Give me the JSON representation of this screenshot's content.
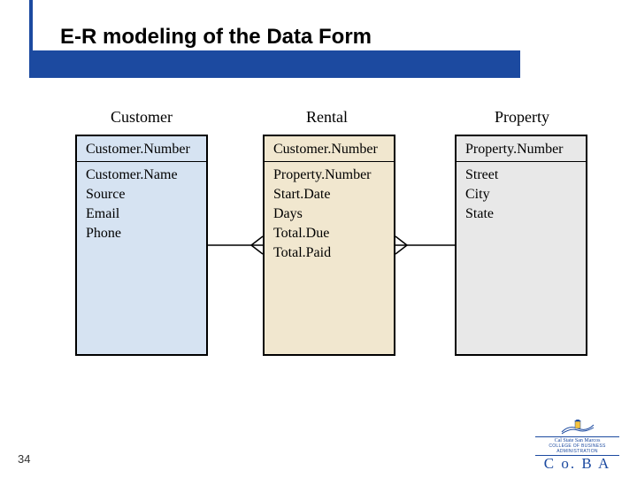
{
  "slide": {
    "title": "E-R modeling of the Data Form",
    "page_number": "34"
  },
  "entities": {
    "customer": {
      "title": "Customer",
      "pk": "Customer.Number",
      "attrs": [
        "Customer.Name",
        "Source",
        "Email",
        "Phone"
      ]
    },
    "rental": {
      "title": "Rental",
      "pk": "Customer.Number",
      "attrs": [
        "Property.Number",
        "Start.Date",
        "Days",
        "Total.Due",
        "Total.Paid"
      ]
    },
    "property": {
      "title": "Property",
      "pk": "Property.Number",
      "attrs": [
        "Street",
        "City",
        "State"
      ]
    }
  },
  "logo": {
    "line1": "Cal State San Marcos",
    "line2": "COLLEGE OF BUSINESS ADMINISTRATION",
    "line3": "C o. B A"
  }
}
